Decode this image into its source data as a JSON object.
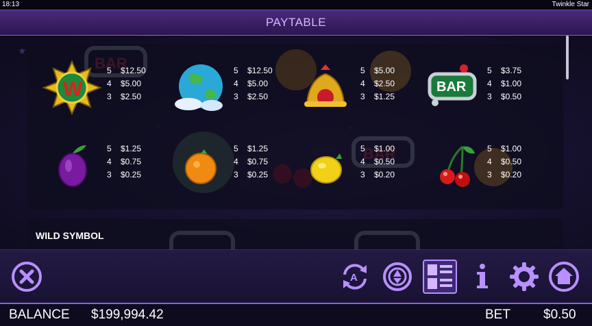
{
  "status": {
    "time": "18:13",
    "game_name": "Twinkle Star"
  },
  "header": {
    "title": "PAYTABLE"
  },
  "paytable": [
    {
      "symbol": "wild-w-symbol",
      "pays": [
        {
          "n": "5",
          "v": "$12.50"
        },
        {
          "n": "4",
          "v": "$5.00"
        },
        {
          "n": "3",
          "v": "$2.50"
        }
      ]
    },
    {
      "symbol": "planet-symbol",
      "pays": [
        {
          "n": "5",
          "v": "$12.50"
        },
        {
          "n": "4",
          "v": "$5.00"
        },
        {
          "n": "3",
          "v": "$2.50"
        }
      ]
    },
    {
      "symbol": "bell-symbol",
      "pays": [
        {
          "n": "5",
          "v": "$5.00"
        },
        {
          "n": "4",
          "v": "$2.50"
        },
        {
          "n": "3",
          "v": "$1.25"
        }
      ]
    },
    {
      "symbol": "bar-symbol",
      "pays": [
        {
          "n": "5",
          "v": "$3.75"
        },
        {
          "n": "4",
          "v": "$1.00"
        },
        {
          "n": "3",
          "v": "$0.50"
        }
      ]
    },
    {
      "symbol": "plum-symbol",
      "pays": [
        {
          "n": "5",
          "v": "$1.25"
        },
        {
          "n": "4",
          "v": "$0.75"
        },
        {
          "n": "3",
          "v": "$0.25"
        }
      ]
    },
    {
      "symbol": "orange-symbol",
      "pays": [
        {
          "n": "5",
          "v": "$1.25"
        },
        {
          "n": "4",
          "v": "$0.75"
        },
        {
          "n": "3",
          "v": "$0.25"
        }
      ]
    },
    {
      "symbol": "lemon-symbol",
      "pays": [
        {
          "n": "5",
          "v": "$1.00"
        },
        {
          "n": "4",
          "v": "$0.50"
        },
        {
          "n": "3",
          "v": "$0.20"
        }
      ]
    },
    {
      "symbol": "cherry-symbol",
      "pays": [
        {
          "n": "5",
          "v": "$1.00"
        },
        {
          "n": "4",
          "v": "$0.50"
        },
        {
          "n": "3",
          "v": "$0.20"
        }
      ]
    }
  ],
  "sections": {
    "wild_title": "WILD SYMBOL"
  },
  "symbol_art": {
    "bar_text": "BAR",
    "wild_letter": "W"
  },
  "controls": {
    "close_icon": "close-icon",
    "autoplay_icon": "autoplay-icon",
    "autoplay_letter": "A",
    "coin_icon": "bet-chip-icon",
    "paytable_icon": "paytable-icon",
    "info_icon": "info-icon",
    "settings_icon": "gear-icon",
    "home_icon": "home-icon"
  },
  "footer": {
    "balance_label": "BALANCE",
    "balance_value": "$199,994.42",
    "bet_label": "BET",
    "bet_value": "$0.50"
  },
  "colors": {
    "accent": "#8a5ff0",
    "title_text": "#d6b6ff",
    "icon": "#b890ff"
  }
}
